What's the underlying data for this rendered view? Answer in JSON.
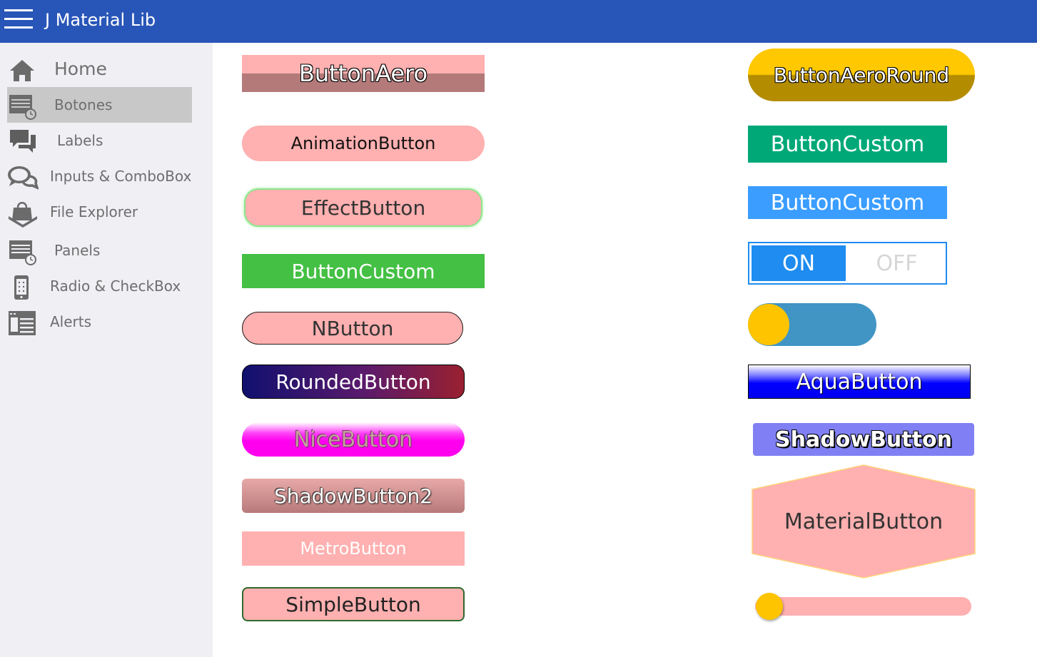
{
  "app": {
    "title": "J Material Lib",
    "menu_icon": "hamburger-menu-icon",
    "header_color": "#2855b8"
  },
  "sidebar": {
    "items": [
      {
        "label": "Home",
        "icon": "home-icon",
        "active": false
      },
      {
        "label": "Botones",
        "icon": "list-clock-icon",
        "active": true
      },
      {
        "label": "Labels",
        "icon": "chat-bubbles-icon",
        "active": false
      },
      {
        "label": "Inputs & ComboBox",
        "icon": "speech-bubbles-icon",
        "active": false
      },
      {
        "label": "File Explorer",
        "icon": "shopping-bag-icon",
        "active": false
      },
      {
        "label": "Panels",
        "icon": "list-clock-icon",
        "active": false
      },
      {
        "label": "Radio & CheckBox",
        "icon": "phone-icon",
        "active": false
      },
      {
        "label": "Alerts",
        "icon": "window-list-icon",
        "active": false
      }
    ]
  },
  "buttons_left": {
    "aero": "ButtonAero",
    "animation": "AnimationButton",
    "effect": "EffectButton",
    "custom": "ButtonCustom",
    "n": "NButton",
    "rounded": "RoundedButton",
    "nice": "NiceButton",
    "shadow2": "ShadowButton2",
    "metro": "MetroButton",
    "simple": "SimpleButton"
  },
  "buttons_right": {
    "aero_round": "ButtonAeroRound",
    "custom_teal": "ButtonCustom",
    "custom_blue": "ButtonCustom",
    "toggle_on": "ON",
    "toggle_off": "OFF",
    "switch_state": "off",
    "aqua": "AquaButton",
    "shadow": "ShadowButton",
    "material": "MaterialButton",
    "slider_value": 0
  },
  "colors": {
    "pink": "#ffb0b0",
    "green": "#44c044",
    "teal": "#00a878",
    "blue": "#3a9dff",
    "toggle_blue": "#1e8cf0",
    "switch_track": "#4095c4",
    "yellow": "#ffc400"
  }
}
